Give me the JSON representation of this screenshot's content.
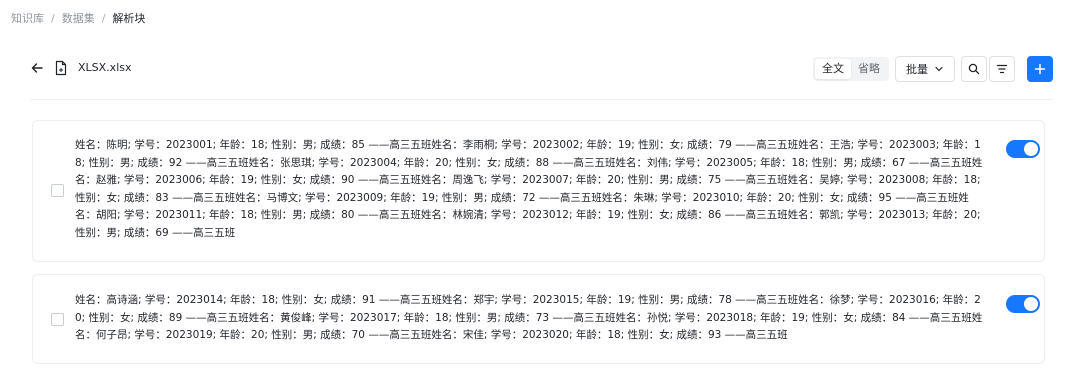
{
  "breadcrumb": {
    "items": [
      "知识库",
      "数据集",
      "解析块"
    ],
    "separator": "/"
  },
  "toolbar": {
    "file_name": "XLSX.xlsx",
    "view_modes": [
      {
        "label": "全文",
        "active": true
      },
      {
        "label": "省略",
        "active": false
      }
    ],
    "batch_label": "批量",
    "accent_color": "#1677ff"
  },
  "chunks": [
    {
      "text": "姓名：陈明; 学号：2023001; 年龄：18; 性别：男; 成绩：85 ——高三五班姓名：李雨桐; 学号：2023002; 年龄：19; 性别：女; 成绩：79 ——高三五班姓名：王浩; 学号：2023003; 年龄：18; 性别：男; 成绩：92 ——高三五班姓名：张思琪; 学号：2023004; 年龄：20; 性别：女; 成绩：88 ——高三五班姓名：刘伟; 学号：2023005; 年龄：18; 性别：男; 成绩：67 ——高三五班姓名：赵雅; 学号：2023006; 年龄：19; 性别：女; 成绩：90 ——高三五班姓名：周逸飞; 学号：2023007; 年龄：20; 性别：男; 成绩：75 ——高三五班姓名：吴婷; 学号：2023008; 年龄：18; 性别：女; 成绩：83 ——高三五班姓名：马博文; 学号：2023009; 年龄：19; 性别：男; 成绩：72 ——高三五班姓名：朱琳; 学号：2023010; 年龄：20; 性别：女; 成绩：95 ——高三五班姓名：胡阳; 学号：2023011; 年龄：18; 性别：男; 成绩：80 ——高三五班姓名：林婉清; 学号：2023012; 年龄：19; 性别：女; 成绩：86 ——高三五班姓名：郭凯; 学号：2023013; 年龄：20; 性别：男; 成绩：69 ——高三五班",
      "enabled": true,
      "checked": false
    },
    {
      "text": "姓名：高诗涵; 学号：2023014; 年龄：18; 性别：女; 成绩：91 ——高三五班姓名：郑宇; 学号：2023015; 年龄：19; 性别：男; 成绩：78 ——高三五班姓名：徐梦; 学号：2023016; 年龄：20; 性别：女; 成绩：89 ——高三五班姓名：黄俊峰; 学号：2023017; 年龄：18; 性别：男; 成绩：73 ——高三五班姓名：孙悦; 学号：2023018; 年龄：19; 性别：女; 成绩：84 ——高三五班姓名：何子昂; 学号：2023019; 年龄：20; 性别：男; 成绩：70 ——高三五班姓名：宋佳; 学号：2023020; 年龄：18; 性别：女; 成绩：93 ——高三五班",
      "enabled": true,
      "checked": false
    }
  ]
}
